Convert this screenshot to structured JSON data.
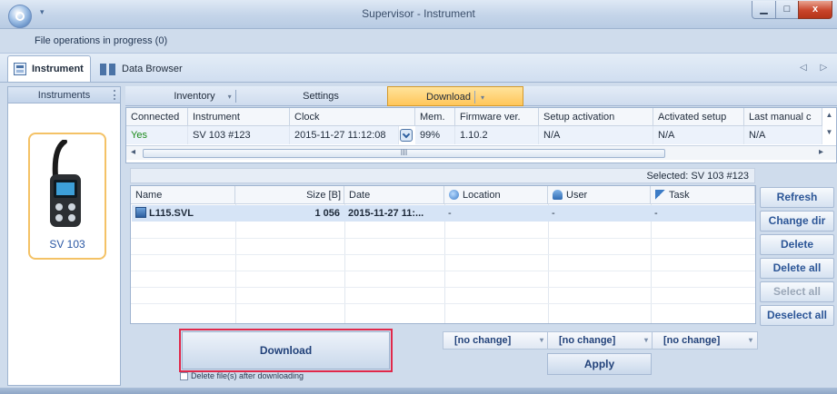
{
  "window": {
    "title": "Supervisor - Instrument",
    "min_glyph": "▁",
    "max_glyph": "□",
    "close_glyph": "x",
    "qa_arrow": "▾"
  },
  "status": "File operations in progress (0)",
  "ribbon": {
    "tabs": [
      {
        "label": "Instrument"
      },
      {
        "label": "Data Browser"
      }
    ],
    "scroll_arrows": "◁ ▷"
  },
  "left_panel": {
    "header": "Instruments",
    "device_name": "SV 103"
  },
  "view_tabs": {
    "inventory": "Inventory",
    "settings": "Settings",
    "download": "Download",
    "dropdown_glyph": "▾"
  },
  "instrument_grid": {
    "headers": [
      "Connected",
      "Instrument",
      "Clock",
      "Mem.",
      "Firmware ver.",
      "Setup activation",
      "Activated setup",
      "Last manual c"
    ],
    "row": [
      "Yes",
      "SV 103 #123",
      "2015-11-27 11:12:08",
      "99%",
      "1.10.2",
      "N/A",
      "N/A",
      "N/A"
    ],
    "scroll_up": "▲",
    "scroll_down": "▼",
    "hscroll_left": "◂",
    "hscroll_right": "▸",
    "thumb_grip": "III"
  },
  "selected_label": "Selected: SV 103 #123",
  "file_grid": {
    "headers": {
      "name": "Name",
      "size": "Size [B]",
      "date": "Date",
      "location": "Location",
      "user": "User",
      "task": "Task"
    },
    "rows": [
      {
        "name": "L115.SVL",
        "size": "1 056",
        "date": "2015-11-27 11:...",
        "location": "-",
        "user": "-",
        "task": "-"
      }
    ]
  },
  "side_buttons": {
    "refresh": "Refresh",
    "change_dir": "Change dir",
    "delete": "Delete",
    "delete_all": "Delete all",
    "select_all": "Select all",
    "deselect_all": "Deselect all"
  },
  "bottom": {
    "download": "Download",
    "delete_after": "Delete file(s) after downloading",
    "combo_location": "[no change]",
    "combo_user": "[no change]",
    "combo_task": "[no change]",
    "apply": "Apply"
  },
  "colors": {
    "accent_orange": "#ffc65a",
    "highlight_red": "#e0284a",
    "connected_green": "#1a8a1a"
  }
}
